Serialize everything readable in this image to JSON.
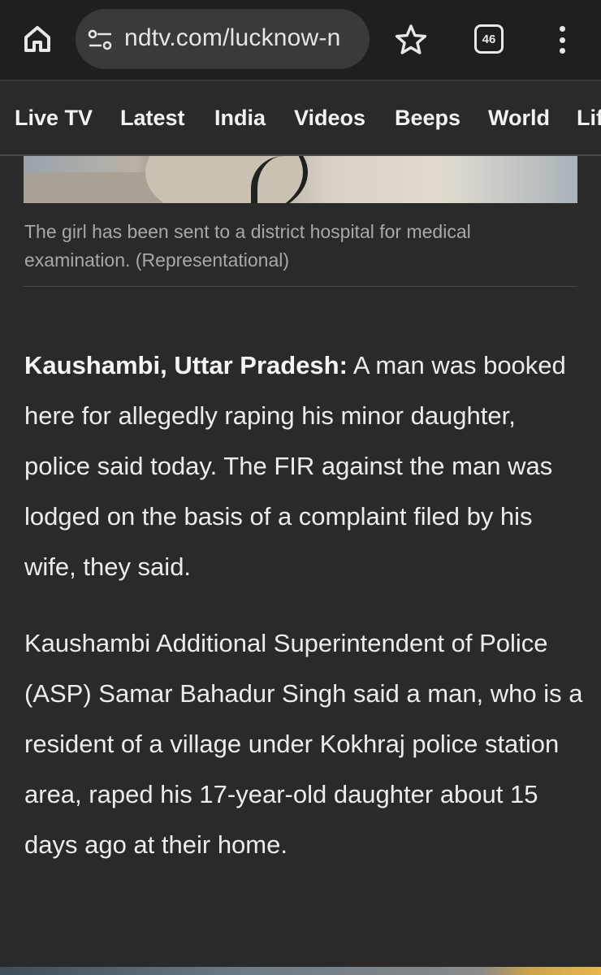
{
  "browser": {
    "url": "ndtv.com/lucknow-n",
    "tab_count": "46",
    "icons": {
      "home": "home-icon",
      "site_settings": "tune-icon",
      "bookmark": "star-icon",
      "tabs": "tab-switcher-icon",
      "menu": "more-vert-icon"
    }
  },
  "nav": {
    "items": [
      "Live TV",
      "Latest",
      "India",
      "Videos",
      "Beeps",
      "World",
      "Lif"
    ]
  },
  "article": {
    "caption": "The girl has been sent to a district hospital for medical examination. (Representational)",
    "dateline": "Kaushambi, Uttar Pradesh:",
    "p1_body": " A man was booked here for allegedly raping his minor daughter, police said today. The FIR against the man was lodged on the basis of a complaint filed by his wife, they said.",
    "p2": "Kaushambi Additional Superintendent of Police (ASP) Samar Bahadur Singh said a man, who is a resident of a village under Kokhraj police station area, raped his 17-year-old daughter about 15 days ago at their home."
  },
  "colors": {
    "page_bg": "#2a2a2a",
    "toolbar_bg": "#1f1f1f",
    "url_box_bg": "#3a3a3c",
    "text": "#ececec",
    "caption_text": "#a8a8a8"
  }
}
